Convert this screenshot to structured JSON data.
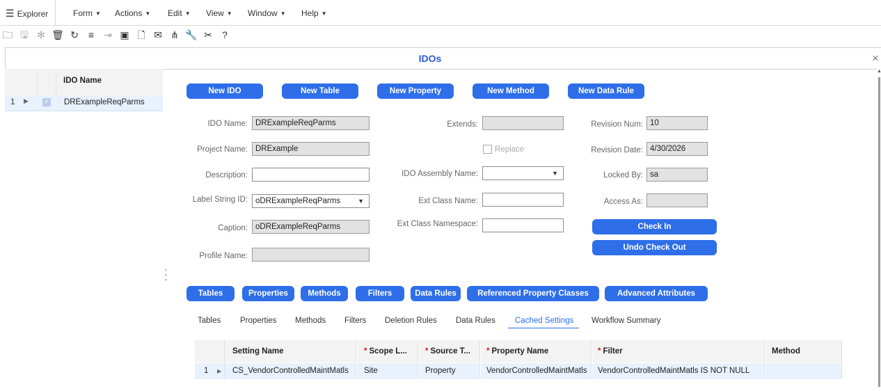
{
  "menubar": {
    "explorer": "Explorer",
    "items": [
      "Form",
      "Actions",
      "Edit",
      "View",
      "Window",
      "Help"
    ]
  },
  "toolbar_icons": [
    "open-folder-icon",
    "save-icon",
    "asterisk-icon",
    "delete-icon",
    "refresh-icon",
    "filter-icon",
    "filter-in-place-icon",
    "clipboard-icon",
    "document-icon",
    "mail-icon",
    "sitemap-icon",
    "wrench-icon",
    "tools-icon",
    "help-icon"
  ],
  "window": {
    "title": "IDOs"
  },
  "left_grid": {
    "header": "IDO Name",
    "row_number": "1",
    "row_value": "DRExampleReqParms"
  },
  "action_buttons": {
    "new_ido": "New IDO",
    "new_table": "New Table",
    "new_property": "New Property",
    "new_method": "New Method",
    "new_data_rule": "New Data Rule"
  },
  "form": {
    "ido_name_label": "IDO Name:",
    "ido_name": "DRExampleReqParms",
    "project_name_label": "Project Name:",
    "project_name": "DRExample",
    "description_label": "Description:",
    "description": "",
    "label_string_id_label": "Label String ID:",
    "label_string_id": "oDRExampleReqParms",
    "caption_label": "Caption:",
    "caption": "oDRExampleReqParms",
    "profile_name_label": "Profile Name:",
    "profile_name": "",
    "extends_label": "Extends:",
    "extends": "",
    "replace_label": "Replace",
    "ido_assembly_label": "IDO Assembly Name:",
    "ido_assembly": "",
    "ext_class_name_label": "Ext Class Name:",
    "ext_class_name": "",
    "ext_class_namespace_label": "Ext Class Namespace:",
    "ext_class_namespace": "",
    "revision_num_label": "Revision Num:",
    "revision_num": "10",
    "revision_date_label": "Revision Date:",
    "revision_date": "4/30/2026",
    "locked_by_label": "Locked By:",
    "locked_by": "sa",
    "access_as_label": "Access As:",
    "access_as": "",
    "check_in": "Check In",
    "undo_check_out": "Undo Check Out"
  },
  "section_buttons": {
    "tables": "Tables",
    "properties": "Properties",
    "methods": "Methods",
    "filters": "Filters",
    "data_rules": "Data Rules",
    "referenced_property_classes": "Referenced Property Classes",
    "advanced_attributes": "Advanced Attributes"
  },
  "tabs": {
    "tables": "Tables",
    "properties": "Properties",
    "methods": "Methods",
    "filters": "Filters",
    "deletion_rules": "Deletion Rules",
    "data_rules": "Data Rules",
    "cached_settings": "Cached Settings",
    "workflow_summary": "Workflow Summary"
  },
  "cached_grid": {
    "columns": {
      "setting_name": "Setting Name",
      "scope": "Scope L...",
      "source": "Source T...",
      "property_name": "Property Name",
      "filter": "Filter",
      "method": "Method"
    },
    "required_mark": "*",
    "row": {
      "num": "1",
      "setting_name": "CS_VendorControlledMaintMatls",
      "scope": "Site",
      "source": "Property",
      "property_name": "VendorControlledMaintMatls",
      "filter": "VendorControlledMaintMatls IS NOT NULL",
      "method": ""
    }
  },
  "colors": {
    "accent": "#2e6ee8",
    "title": "#2b5bd7",
    "row_highlight": "#e8f1fc"
  }
}
